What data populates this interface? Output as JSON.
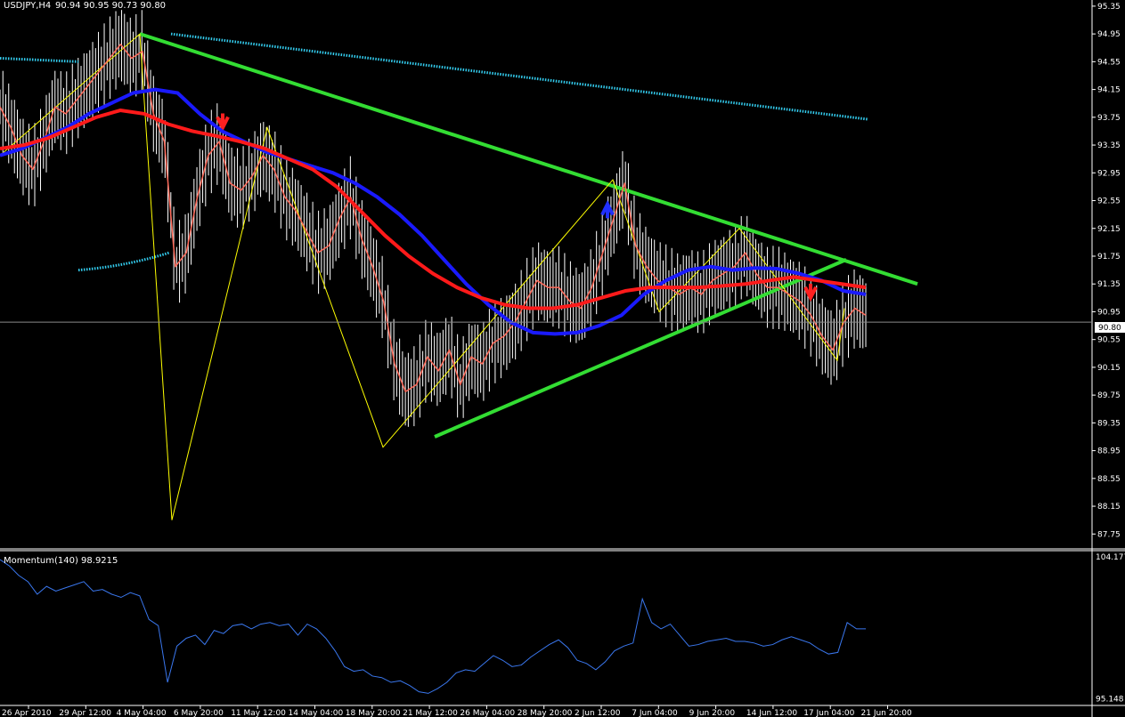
{
  "header": {
    "symbol": "USDJPY,H4",
    "ohlc": "90.94 90.95 90.73 90.80"
  },
  "momentum_header": "Momentum(140) 98.9215",
  "current_price_label": "90.80",
  "colors": {
    "background": "#000000",
    "candles": "#ffffff",
    "price_line": "#ff6a5a",
    "ma_fast": "#1a1aff",
    "ma_slow": "#ff1a1a",
    "trendline": "#33dd33",
    "envelope": "#33ccee",
    "zigzag": "#ffff00",
    "momentum": "#3a77ee",
    "arrow_down": "#ff2020",
    "arrow_up": "#2030ff"
  },
  "chart_data": [
    {
      "type": "line",
      "panel": "main",
      "y_ticks": [
        "95.35",
        "94.95",
        "94.55",
        "94.15",
        "93.75",
        "93.35",
        "92.95",
        "92.55",
        "92.15",
        "91.75",
        "91.35",
        "90.95",
        "90.55",
        "90.15",
        "89.75",
        "89.35",
        "88.95",
        "88.55",
        "88.15",
        "87.75"
      ],
      "ylim": [
        87.6,
        95.4
      ],
      "x_ticks": [
        "26 Apr 2010",
        "29 Apr 12:00",
        "4 May 04:00",
        "6 May 20:00",
        "11 May 12:00",
        "14 May 04:00",
        "18 May 20:00",
        "21 May 12:00",
        "26 May 04:00",
        "28 May 20:00",
        "2 Jun 12:00",
        "7 Jun 04:00",
        "9 Jun 20:00",
        "14 Jun 12:00",
        "17 Jun 04:00",
        "21 Jun 20:00"
      ],
      "series": [
        {
          "key": "price",
          "values": [
            93.9,
            93.6,
            93.2,
            93.0,
            93.4,
            93.9,
            93.8,
            94.0,
            94.2,
            94.4,
            94.6,
            94.8,
            94.6,
            94.7,
            93.8,
            93.4,
            91.6,
            91.8,
            92.6,
            93.2,
            93.4,
            92.8,
            92.7,
            92.9,
            93.2,
            93.0,
            92.6,
            92.4,
            92.1,
            91.8,
            91.9,
            92.3,
            92.6,
            92.0,
            91.6,
            91.1,
            90.2,
            89.8,
            89.9,
            90.3,
            90.1,
            90.4,
            89.9,
            90.3,
            90.2,
            90.5,
            90.6,
            90.8,
            91.1,
            91.4,
            91.3,
            91.3,
            91.1,
            91.0,
            91.3,
            91.8,
            92.3,
            92.8,
            91.9,
            91.6,
            91.4,
            91.3,
            91.2,
            91.3,
            91.2,
            91.4,
            91.5,
            91.6,
            91.8,
            91.5,
            91.3,
            91.3,
            91.2,
            91.1,
            90.9,
            90.6,
            90.4,
            90.8,
            91.0,
            90.9
          ],
          "width": 1.5
        },
        {
          "key": "ma_fast",
          "values": [
            93.2,
            93.3,
            93.45,
            93.6,
            93.8,
            93.95,
            94.1,
            94.15,
            94.1,
            93.8,
            93.55,
            93.4,
            93.25,
            93.15,
            93.05,
            92.95,
            92.8,
            92.6,
            92.35,
            92.05,
            91.7,
            91.35,
            91.05,
            90.8,
            90.65,
            90.63,
            90.65,
            90.75,
            90.9,
            91.2,
            91.4,
            91.55,
            91.6,
            91.55,
            91.58,
            91.57,
            91.5,
            91.4,
            91.25,
            91.2
          ],
          "width": 4
        },
        {
          "key": "ma_slow",
          "values": [
            93.3,
            93.35,
            93.45,
            93.6,
            93.75,
            93.85,
            93.8,
            93.65,
            93.55,
            93.48,
            93.4,
            93.3,
            93.15,
            93.0,
            92.75,
            92.4,
            92.05,
            91.75,
            91.5,
            91.3,
            91.15,
            91.05,
            91.0,
            91.0,
            91.05,
            91.15,
            91.25,
            91.3,
            91.3,
            91.3,
            91.32,
            91.35,
            91.4,
            91.45,
            91.4,
            91.35,
            91.3
          ],
          "width": 4
        }
      ]
    },
    {
      "type": "line",
      "panel": "momentum",
      "y_ticks": [
        "104.177",
        "95.148"
      ],
      "ylim": [
        94.9,
        104.4
      ],
      "series": [
        {
          "key": "momentum",
          "values": [
            104.0,
            103.6,
            103.0,
            102.6,
            101.8,
            102.3,
            102.0,
            102.2,
            102.4,
            102.6,
            102.0,
            102.1,
            101.8,
            101.6,
            101.9,
            101.7,
            100.2,
            99.8,
            96.2,
            98.5,
            99.0,
            99.2,
            98.6,
            99.5,
            99.3,
            99.8,
            99.9,
            99.6,
            99.9,
            100.0,
            99.8,
            99.9,
            99.2,
            99.9,
            99.6,
            99.0,
            98.2,
            97.2,
            96.9,
            97.0,
            96.6,
            96.5,
            96.2,
            96.3,
            96.0,
            95.6,
            95.5,
            95.8,
            96.2,
            96.8,
            97.0,
            96.9,
            97.4,
            97.9,
            97.6,
            97.2,
            97.3,
            97.8,
            98.2,
            98.6,
            98.9,
            98.4,
            97.6,
            97.4,
            97.0,
            97.5,
            98.2,
            98.5,
            98.7,
            101.5,
            100.0,
            99.6,
            99.9,
            99.2,
            98.5,
            98.6,
            98.8,
            98.9,
            99.0,
            98.8,
            98.8,
            98.7,
            98.5,
            98.6,
            98.9,
            99.1,
            98.9,
            98.7,
            98.3,
            98.0,
            98.1,
            100.0,
            99.6,
            99.6
          ],
          "width": 1
        }
      ]
    }
  ]
}
